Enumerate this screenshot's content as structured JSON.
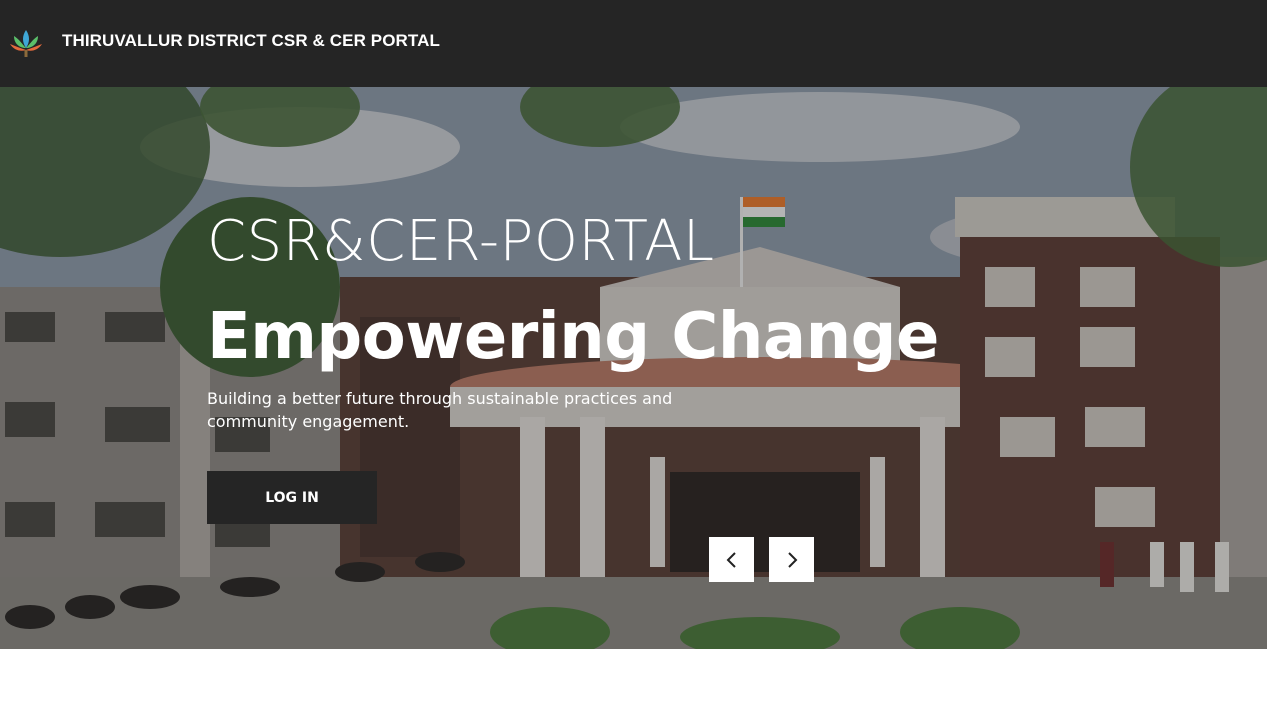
{
  "header": {
    "logo_icon": "lotus-logo-icon",
    "title": "THIRUVALLUR DISTRICT CSR & CER PORTAL",
    "background": "#252525"
  },
  "hero": {
    "eyebrow": "CSR&CER-PORTAL",
    "headline": "Empowering Change",
    "subtitle": "Building a better future through sustainable practices and community engagement.",
    "login_label": "LOG IN",
    "prev_icon": "chevron-left-icon",
    "next_icon": "chevron-right-icon"
  }
}
